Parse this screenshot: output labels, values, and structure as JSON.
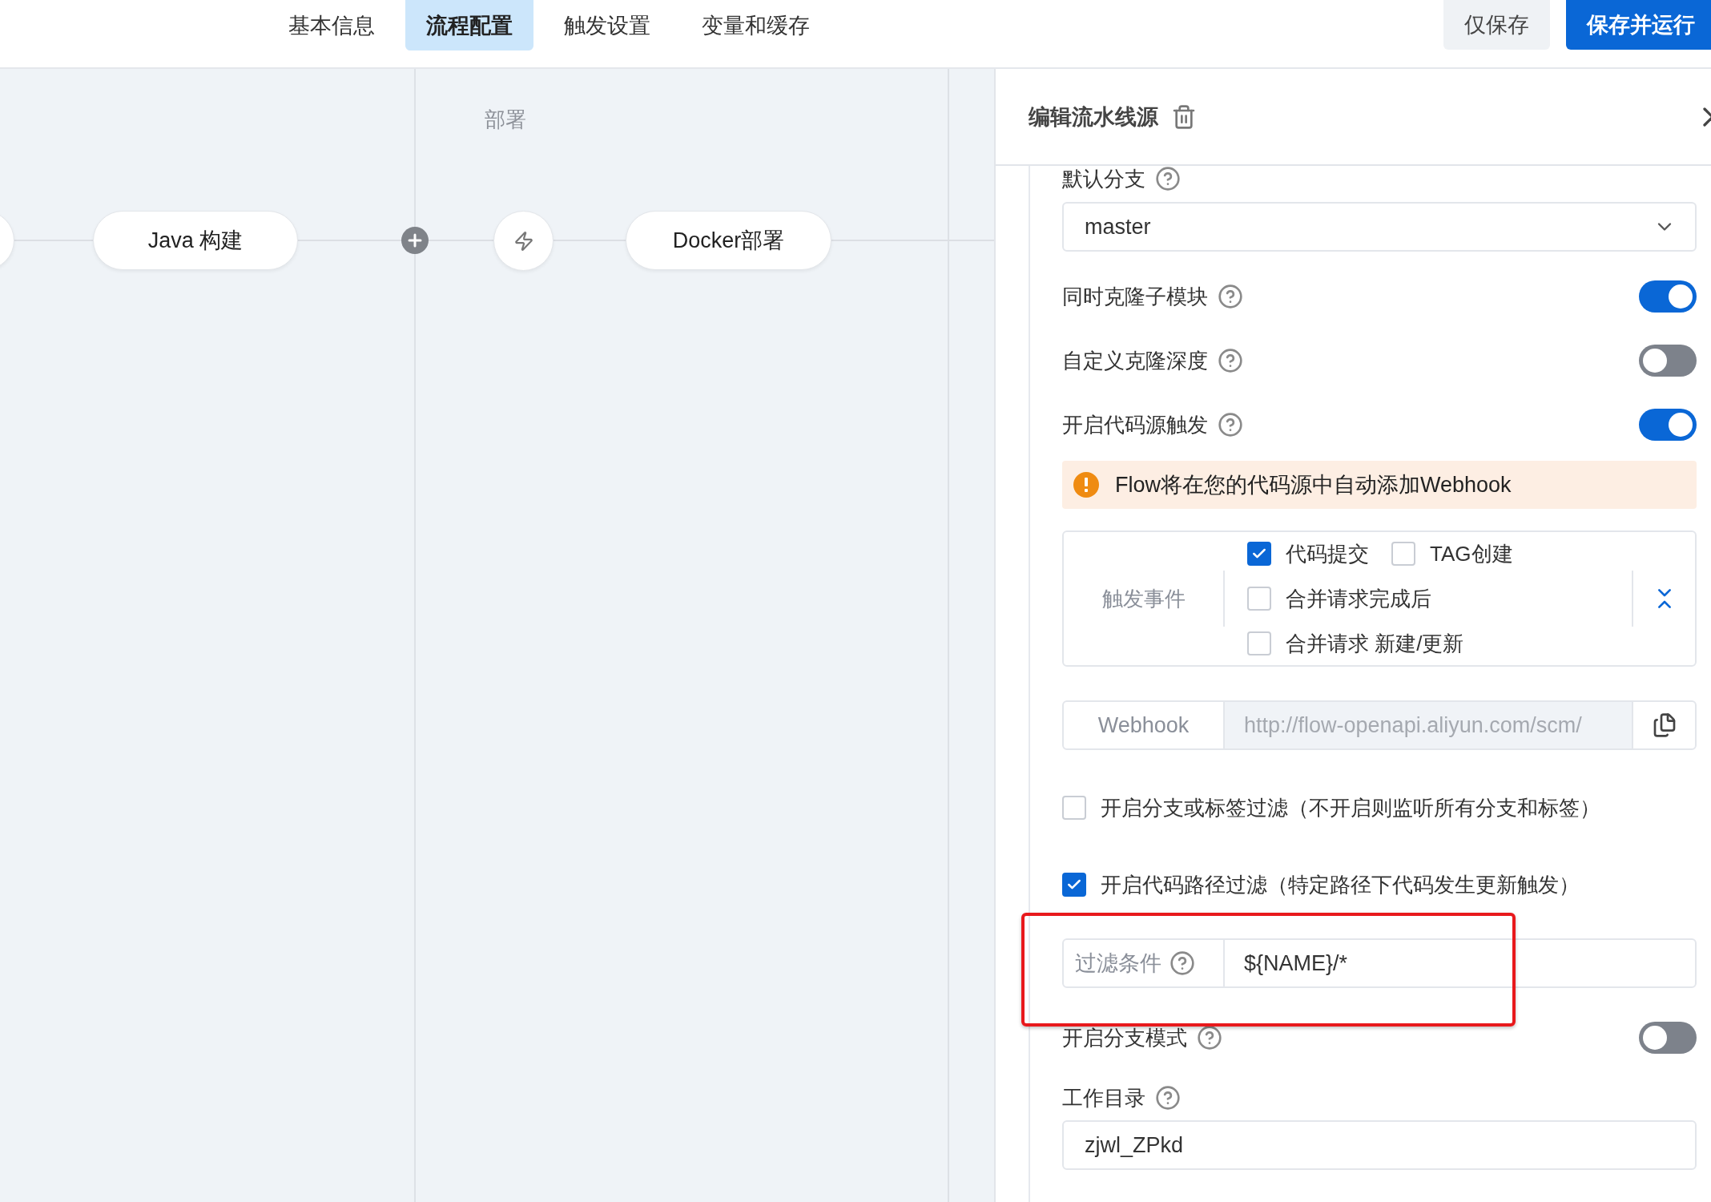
{
  "tabs": [
    {
      "label": "基本信息",
      "selected": false
    },
    {
      "label": "流程配置",
      "selected": true
    },
    {
      "label": "触发设置",
      "selected": false
    },
    {
      "label": "变量和缓存",
      "selected": false
    }
  ],
  "actions": [
    {
      "label": "仅保存",
      "kind": "secondary"
    },
    {
      "label": "保存并运行",
      "kind": "primary"
    }
  ],
  "canvas": {
    "stage_label": "部署",
    "nodes": [
      {
        "kind": "stub"
      },
      {
        "kind": "job",
        "label": "Java 构建"
      },
      {
        "kind": "add"
      },
      {
        "kind": "trigger"
      },
      {
        "kind": "job",
        "label": "Docker部署"
      }
    ]
  },
  "panel": {
    "title": "编辑流水线源",
    "default_branch": {
      "label": "默认分支",
      "value": "master"
    },
    "switches": [
      {
        "label": "同时克隆子模块",
        "on": true
      },
      {
        "label": "自定义克隆深度",
        "on": false
      },
      {
        "label": "开启代码源触发",
        "on": true
      }
    ],
    "alert": "Flow将在您的代码源中自动添加Webhook",
    "trigger_events": {
      "label": "触发事件",
      "option_rows": [
        [
          {
            "label": "代码提交",
            "checked": true
          },
          {
            "label": "TAG创建",
            "checked": false
          }
        ],
        [
          {
            "label": "合并请求完成后",
            "checked": false
          }
        ],
        [
          {
            "label": "合并请求 新建/更新",
            "checked": false
          }
        ]
      ]
    },
    "webhook": {
      "label": "Webhook",
      "value": "http://flow-openapi.aliyun.com/scm/"
    },
    "filters": [
      {
        "label": "开启分支或标签过滤（不开启则监听所有分支和标签）",
        "checked": false
      },
      {
        "label": "开启代码路径过滤（特定路径下代码发生更新触发）",
        "checked": true
      }
    ],
    "filter_condition": {
      "label": "过滤条件",
      "value": "${NAME}/*",
      "highlighted": true
    },
    "branch_mode": {
      "label": "开启分支模式",
      "on": false
    },
    "work_dir": {
      "label": "工作目录",
      "value": "zjwl_ZPkd"
    }
  }
}
